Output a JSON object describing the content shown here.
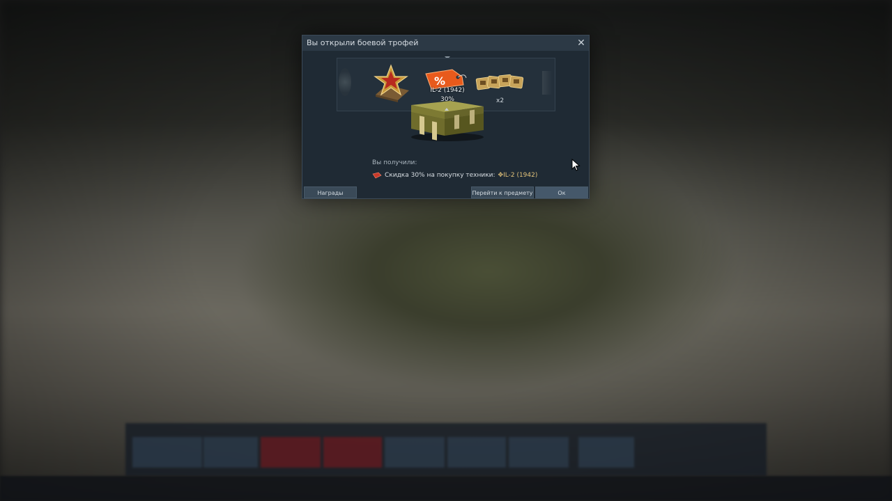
{
  "dialog": {
    "title": "Вы открыли боевой трофей",
    "close_icon": "close-icon",
    "carousel": {
      "items": [
        {
          "icon": "star-badge-icon"
        },
        {
          "icon": "discount-tag-icon",
          "vehicle": "IL-2 (1942)",
          "percent": "30%"
        },
        {
          "icon": "cards-icon",
          "count": "x2"
        }
      ]
    },
    "received_label": "Вы получили:",
    "reward": {
      "icon": "discount-ticket-icon",
      "text": "Скидка 30% на покупку техники:",
      "vehicle": "IL-2 (1942)"
    },
    "buttons": {
      "rewards": "Награды",
      "goto": "Перейти к предмету",
      "ok": "Ок"
    }
  },
  "colors": {
    "dialog_bg": "#1f2a34",
    "header_bg": "#2c3945",
    "button_bg": "#3a4a58",
    "vehicle_highlight": "#e2c27a",
    "discount_orange": "#e85a1c"
  }
}
